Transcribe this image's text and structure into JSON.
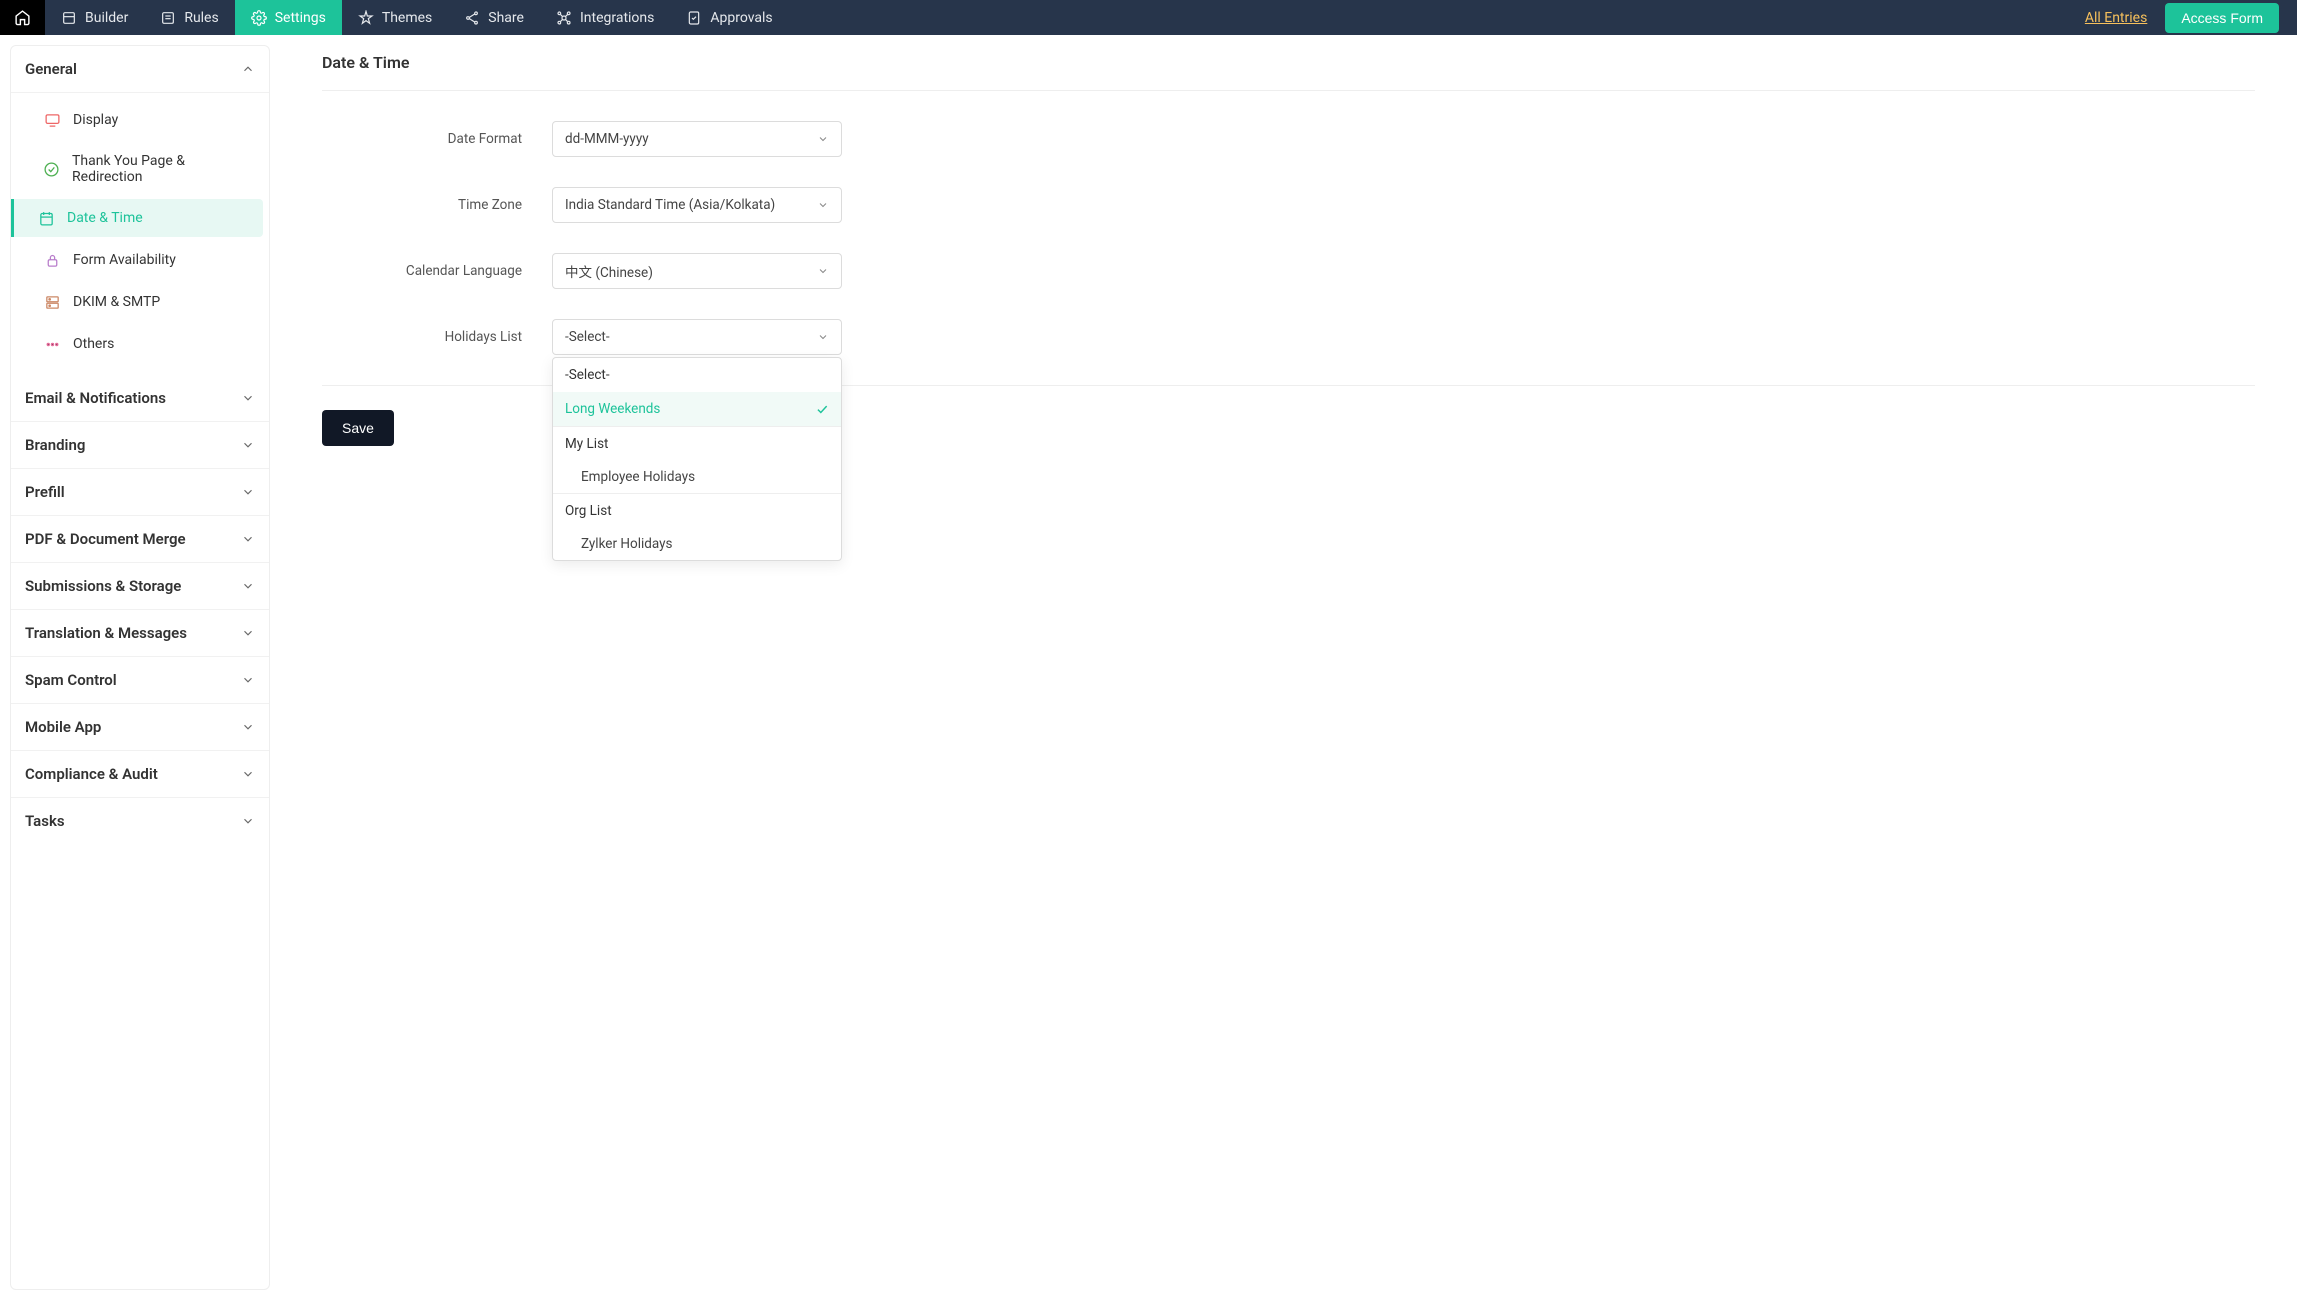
{
  "topnav": {
    "items": [
      {
        "label": "Builder"
      },
      {
        "label": "Rules"
      },
      {
        "label": "Settings",
        "active": true
      },
      {
        "label": "Themes"
      },
      {
        "label": "Share"
      },
      {
        "label": "Integrations"
      },
      {
        "label": "Approvals"
      }
    ],
    "all_entries": "All Entries",
    "access_form": "Access Form"
  },
  "sidebar": {
    "sections": [
      {
        "title": "General",
        "expanded": true,
        "items": [
          {
            "label": "Display",
            "icon": "display-icon",
            "color": "#e66"
          },
          {
            "label": "Thank You Page & Redirection",
            "icon": "check-circle-icon",
            "color": "#4caf50"
          },
          {
            "label": "Date & Time",
            "icon": "calendar-icon",
            "color": "#1dc39a",
            "active": true
          },
          {
            "label": "Form Availability",
            "icon": "lock-icon",
            "color": "#b87dcb"
          },
          {
            "label": "DKIM & SMTP",
            "icon": "server-icon",
            "color": "#c86"
          },
          {
            "label": "Others",
            "icon": "dots-icon",
            "color": "#e66a9a"
          }
        ]
      },
      {
        "title": "Email & Notifications",
        "expanded": false
      },
      {
        "title": "Branding",
        "expanded": false
      },
      {
        "title": "Prefill",
        "expanded": false
      },
      {
        "title": "PDF & Document Merge",
        "expanded": false
      },
      {
        "title": "Submissions & Storage",
        "expanded": false
      },
      {
        "title": "Translation & Messages",
        "expanded": false
      },
      {
        "title": "Spam Control",
        "expanded": false
      },
      {
        "title": "Mobile App",
        "expanded": false
      },
      {
        "title": "Compliance & Audit",
        "expanded": false
      },
      {
        "title": "Tasks",
        "expanded": false
      }
    ]
  },
  "page": {
    "title": "Date & Time",
    "fields": {
      "date_format": {
        "label": "Date Format",
        "value": "dd-MMM-yyyy"
      },
      "time_zone": {
        "label": "Time Zone",
        "value": "India Standard Time   (Asia/Kolkata)"
      },
      "calendar_language": {
        "label": "Calendar Language",
        "value": "中文 (Chinese)"
      },
      "holidays_list": {
        "label": "Holidays List",
        "value": "-Select-",
        "options": {
          "top": [
            {
              "label": "-Select-"
            },
            {
              "label": "Long Weekends",
              "highlight": true
            }
          ],
          "groups": [
            {
              "label": "My List",
              "items": [
                {
                  "label": "Employee Holidays"
                }
              ]
            },
            {
              "label": "Org List",
              "items": [
                {
                  "label": "Zylker Holidays"
                }
              ]
            }
          ]
        }
      }
    },
    "save": "Save"
  }
}
